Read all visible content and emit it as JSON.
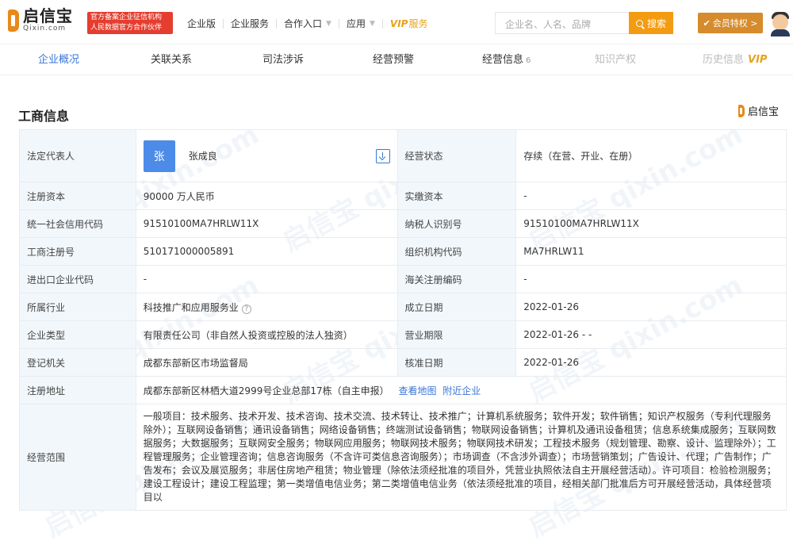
{
  "header": {
    "logo_cn": "启信宝",
    "logo_en": "Qixin.com",
    "cert_line1": "官方备案企业征信机构",
    "cert_line2": "人民数据官方合作伙伴",
    "nav": [
      {
        "label": "企业版"
      },
      {
        "label": "企业服务"
      },
      {
        "label": "合作入口"
      },
      {
        "label": "应用"
      }
    ],
    "vip_brand": "VIP",
    "vip_suffix": "服务",
    "search_placeholder": "企业名、人名、品牌",
    "search_button": "搜索",
    "member_button": "会员特权 >"
  },
  "tabs": [
    {
      "label": "企业概况",
      "state": "active"
    },
    {
      "label": "关联关系",
      "state": "normal"
    },
    {
      "label": "司法涉诉",
      "state": "normal"
    },
    {
      "label": "经营预警",
      "state": "normal"
    },
    {
      "label": "经营信息",
      "count": "6",
      "state": "normal"
    },
    {
      "label": "知识产权",
      "state": "disabled"
    },
    {
      "label": "历史信息",
      "vip": "VIP",
      "state": "disabled"
    }
  ],
  "section": {
    "title": "工商信息",
    "brand": "启信宝"
  },
  "legal_rep": {
    "label": "法定代表人",
    "avatar_char": "张",
    "name": "张成良"
  },
  "rows": [
    {
      "l1": "注册资本",
      "v1": "90000 万人民币",
      "l2": "实缴资本",
      "v2": "-"
    },
    {
      "l1": "统一社会信用代码",
      "v1": "91510100MA7HRLW11X",
      "l2": "纳税人识别号",
      "v2": "91510100MA7HRLW11X"
    },
    {
      "l1": "工商注册号",
      "v1": "510171000005891",
      "l2": "组织机构代码",
      "v2": "MA7HRLW11"
    },
    {
      "l1": "进出口企业代码",
      "v1": "-",
      "l2": "海关注册编码",
      "v2": "-"
    },
    {
      "l1": "所属行业",
      "v1": "科技推广和应用服务业",
      "l2": "成立日期",
      "v2": "2022-01-26"
    },
    {
      "l1": "企业类型",
      "v1": "有限责任公司（非自然人投资或控股的法人独资）",
      "l2": "营业期限",
      "v2": "2022-01-26 - -"
    },
    {
      "l1": "登记机关",
      "v1": "成都东部新区市场监督局",
      "l2": "核准日期",
      "v2": "2022-01-26"
    }
  ],
  "status": {
    "label": "经营状态",
    "value": "存续（在营、开业、在册）"
  },
  "address": {
    "label": "注册地址",
    "value": "成都东部新区林栖大道2999号企业总部17栋（自主申报）",
    "map_link": "查看地图",
    "nearby_link": "附近企业"
  },
  "scope": {
    "label": "经营范围",
    "value": "一般项目：技术服务、技术开发、技术咨询、技术交流、技术转让、技术推广；计算机系统服务；软件开发；软件销售；知识产权服务（专利代理服务除外）；互联网设备销售；通讯设备销售；网络设备销售；终端测试设备销售；物联网设备销售；计算机及通讯设备租赁；信息系统集成服务；互联网数据服务；大数据服务；互联网安全服务；物联网应用服务；物联网技术服务；物联网技术研发；工程技术服务（规划管理、勘察、设计、监理除外）；工程管理服务；企业管理咨询；信息咨询服务（不含许可类信息咨询服务）；市场调查（不含涉外调查）；市场营销策划；广告设计、代理；广告制作；广告发布；会议及展览服务；非居住房地产租赁；物业管理（除依法须经批准的项目外，凭营业执照依法自主开展经营活动）。许可项目：检验检测服务；建设工程设计；建设工程监理；第一类增值电信业务；第二类增值电信业务（依法须经批准的项目，经相关部门批准后方可开展经营活动，具体经营项目以"
  }
}
